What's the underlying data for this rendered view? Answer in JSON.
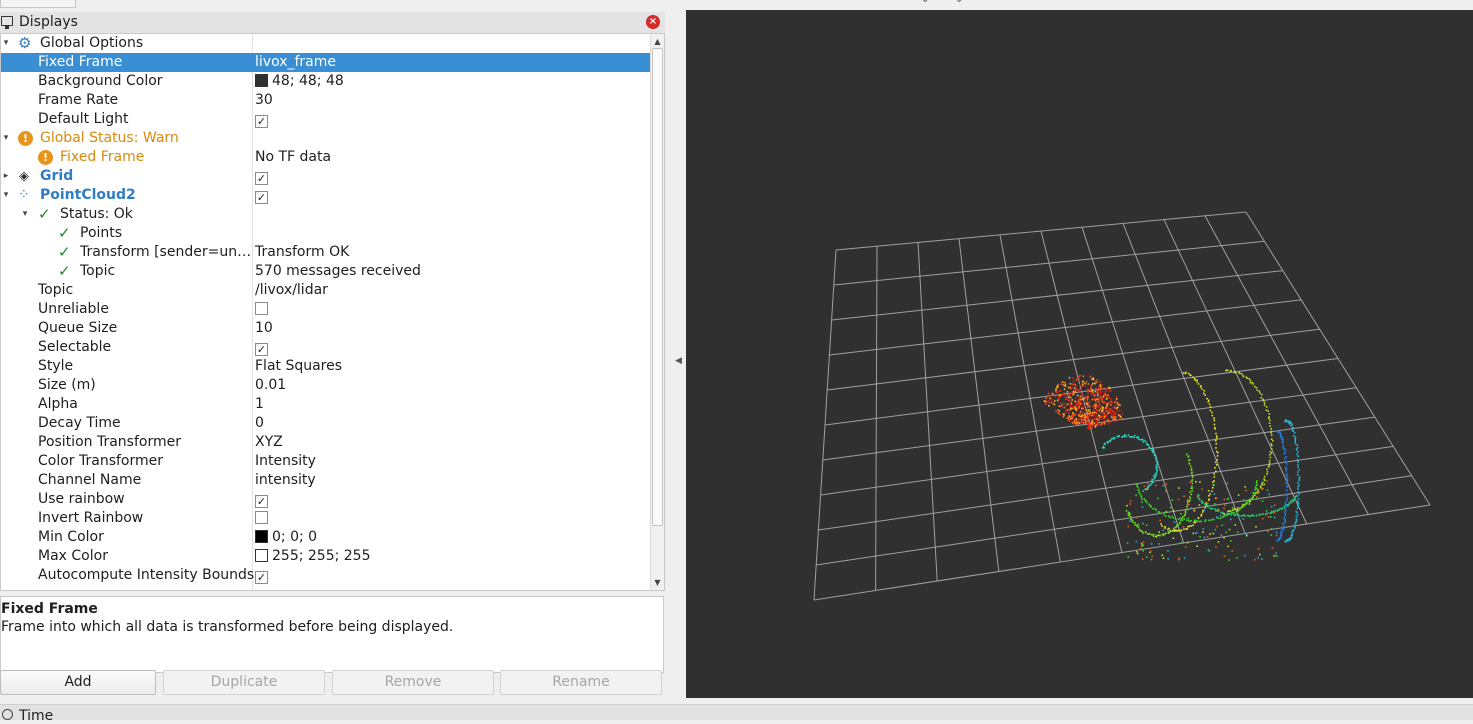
{
  "displays": {
    "title": "Displays",
    "rows": [
      {
        "name": "Global Options",
        "value": ""
      },
      {
        "name": "Fixed Frame",
        "value": "livox_frame"
      },
      {
        "name": "Background Color",
        "value": "48; 48; 48"
      },
      {
        "name": "Frame Rate",
        "value": "30"
      },
      {
        "name": "Default Light",
        "value": ""
      },
      {
        "name": "Global Status: Warn",
        "value": ""
      },
      {
        "name": "Fixed Frame",
        "value": "No TF data"
      },
      {
        "name": "Grid",
        "value": ""
      },
      {
        "name": "PointCloud2",
        "value": ""
      },
      {
        "name": "Status: Ok",
        "value": ""
      },
      {
        "name": "Points",
        "value": ""
      },
      {
        "name": "Transform [sender=un…",
        "value": "Transform OK"
      },
      {
        "name": "Topic",
        "value": "570 messages received"
      },
      {
        "name": "Topic",
        "value": "/livox/lidar"
      },
      {
        "name": "Unreliable",
        "value": ""
      },
      {
        "name": "Queue Size",
        "value": "10"
      },
      {
        "name": "Selectable",
        "value": ""
      },
      {
        "name": "Style",
        "value": "Flat Squares"
      },
      {
        "name": "Size (m)",
        "value": "0.01"
      },
      {
        "name": "Alpha",
        "value": "1"
      },
      {
        "name": "Decay Time",
        "value": "0"
      },
      {
        "name": "Position Transformer",
        "value": "XYZ"
      },
      {
        "name": "Color Transformer",
        "value": "Intensity"
      },
      {
        "name": "Channel Name",
        "value": "intensity"
      },
      {
        "name": "Use rainbow",
        "value": ""
      },
      {
        "name": "Invert Rainbow",
        "value": ""
      },
      {
        "name": "Min Color",
        "value": "0; 0; 0"
      },
      {
        "name": "Max Color",
        "value": "255; 255; 255"
      },
      {
        "name": "Autocompute Intensity Bounds",
        "value": ""
      }
    ],
    "checkboxes": {
      "default_light": true,
      "grid_enabled": true,
      "pointcloud2_enabled": true,
      "unreliable": false,
      "selectable": true,
      "use_rainbow": true,
      "invert_rainbow": false,
      "autocompute_intensity_bounds": true
    },
    "swatches": {
      "background_color": "#303030",
      "min_color": "#000000",
      "max_color": "#ffffff"
    }
  },
  "description": {
    "title": "Fixed Frame",
    "text": "Frame into which all data is transformed before being displayed."
  },
  "buttons": {
    "add": "Add",
    "duplicate": "Duplicate",
    "remove": "Remove",
    "rename": "Rename"
  },
  "time_panel": {
    "label": "Time"
  },
  "colors": {
    "selection": "#3a8fd4",
    "warn": "#d68a10",
    "plugin_name": "#2f7dc4",
    "ok_check": "#1b8a2c",
    "viewport_background": "#303030",
    "grid_lines": "#a0a0a0"
  }
}
